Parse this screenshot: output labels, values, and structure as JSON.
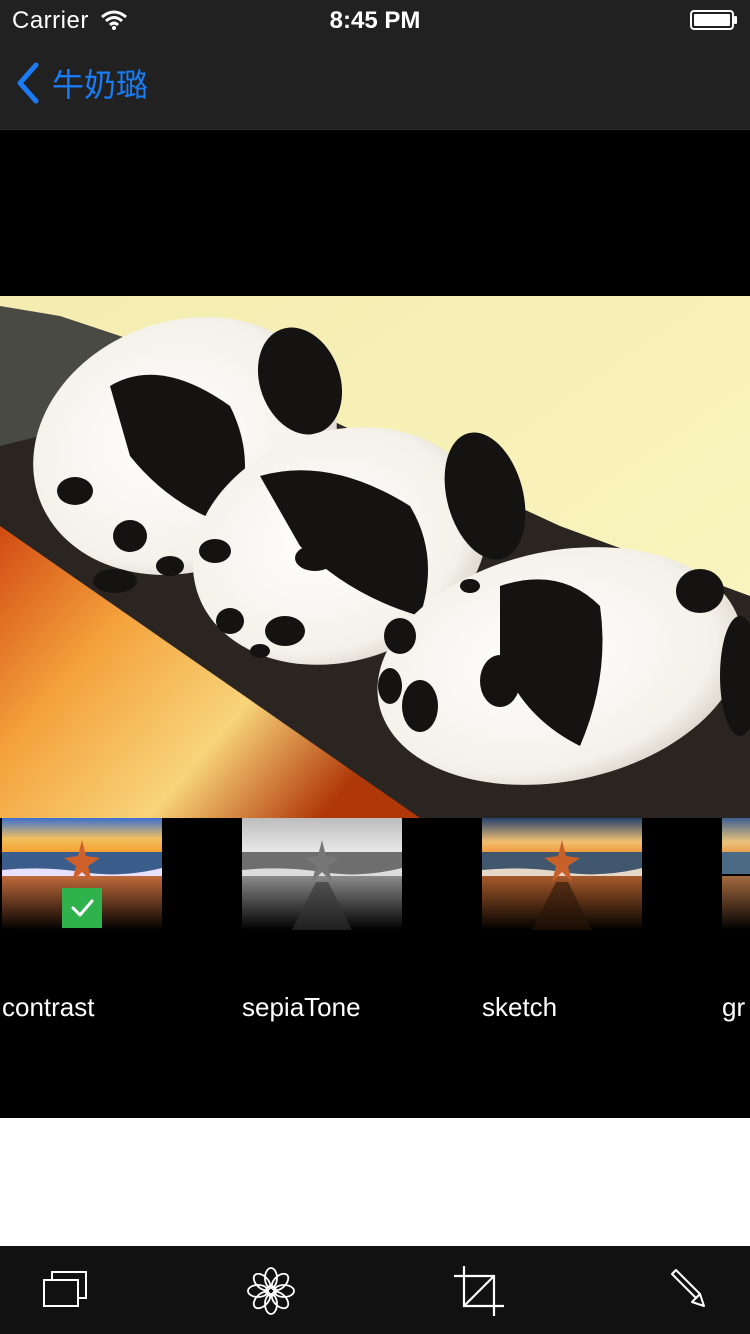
{
  "status_bar": {
    "carrier": "Carrier",
    "time": "8:45 PM",
    "icons": [
      "wifi-icon",
      "battery-icon"
    ]
  },
  "nav": {
    "back_label": "牛奶璐",
    "back_icon": "chevron-left-icon",
    "accent_color": "#1a7cf4"
  },
  "photo": {
    "subject": "three panda plush toys"
  },
  "filters": [
    {
      "label": "contrast",
      "selected": true
    },
    {
      "label": "sepiaTone",
      "selected": false
    },
    {
      "label": "sketch",
      "selected": false
    },
    {
      "label": "gr",
      "selected": false
    }
  ],
  "toolbar": {
    "items": [
      {
        "icon": "layers-icon"
      },
      {
        "icon": "flower-filter-icon"
      },
      {
        "icon": "crop-icon"
      },
      {
        "icon": "pencil-icon"
      }
    ]
  },
  "colors": {
    "bar_background": "#212121",
    "selected_check": "#2fb24c"
  }
}
